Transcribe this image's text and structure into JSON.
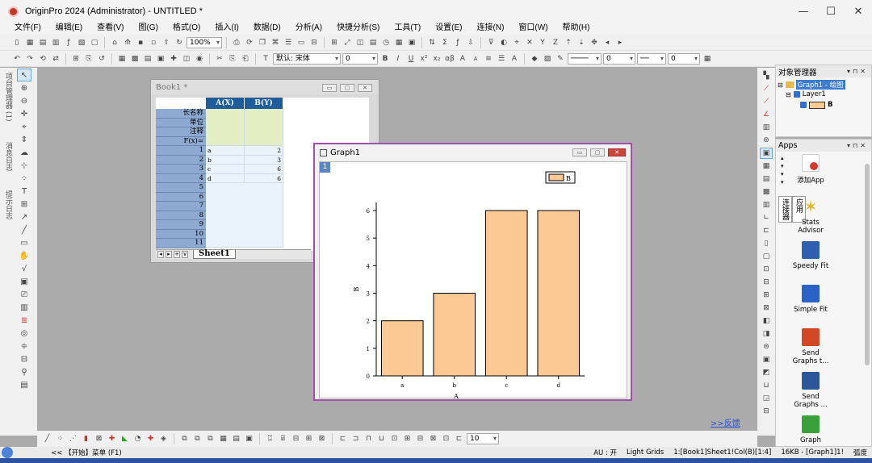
{
  "window": {
    "title": "OriginPro 2024 (Administrator) - UNTITLED *",
    "min_icon": "—",
    "max_icon": "☐",
    "close_icon": "✕"
  },
  "menu": [
    "文件(F)",
    "编辑(E)",
    "查看(V)",
    "图(G)",
    "格式(O)",
    "插入(I)",
    "数据(D)",
    "分析(A)",
    "快捷分析(S)",
    "工具(T)",
    "设置(E)",
    "连接(N)",
    "窗口(W)",
    "帮助(H)"
  ],
  "toolbar": {
    "zoom": "100%",
    "font": "默认: 宋体",
    "font_size": "0",
    "bold": "B",
    "italic": "I",
    "underline": "U",
    "x2": "x²",
    "x_2": "x₂",
    "greek": "αβ",
    "bigA": "A",
    "smallA": "A",
    "line_width": "0",
    "font_size2": "0",
    "sym_size": "10"
  },
  "left_labels": [
    "项目管理器 (1)",
    "消息日志",
    "提示日志"
  ],
  "book": {
    "title": "Book1 *",
    "columns": [
      "A(X)",
      "B(Y)"
    ],
    "header_rows": [
      "长名称",
      "单位",
      "注释",
      "F(x)="
    ],
    "row_numbers": [
      "1",
      "2",
      "3",
      "4",
      "5",
      "6",
      "7",
      "8",
      "9",
      "10",
      "11"
    ],
    "col_a": [
      "a",
      "b",
      "c",
      "d"
    ],
    "col_b": [
      "2",
      "3",
      "6",
      "6"
    ],
    "sheet_tab": "Sheet1",
    "nav": [
      "◂",
      "▸",
      "+",
      "∨"
    ]
  },
  "graph": {
    "title": "Graph1",
    "layer": "1",
    "legend_label": "B",
    "xlabel": "A",
    "ylabel": "B"
  },
  "chart_data": {
    "type": "bar",
    "categories": [
      "a",
      "b",
      "c",
      "d"
    ],
    "values": [
      2,
      3,
      6,
      6
    ],
    "xlabel": "A",
    "ylabel": "B",
    "ylim": [
      0,
      6
    ],
    "yticks": [
      "0",
      "1",
      "2",
      "3",
      "4",
      "5",
      "6"
    ],
    "bar_color": "#fcc994",
    "legend": {
      "entries": [
        "B"
      ],
      "placement": "top-right"
    }
  },
  "object_manager": {
    "title": "对象管理器",
    "graph_node": "Graph1 - 绘图",
    "layer_node": "Layer1",
    "plot_node": "B"
  },
  "apps": {
    "title": "Apps",
    "tabs": [
      "应用",
      "连接器"
    ],
    "items": [
      {
        "label": "添加App",
        "color": "#d33b2f"
      },
      {
        "label": "Stats Advisor",
        "color": "#e8b41f"
      },
      {
        "label": "Speedy Fit",
        "color": "#2f5fb0"
      },
      {
        "label": "Simple Fit",
        "color": "#2a63c8"
      },
      {
        "label": "Send Graphs t...",
        "color": "#d24726"
      },
      {
        "label": "Send Graphs ...",
        "color": "#2b579a"
      },
      {
        "label": "Graph",
        "color": "#3aa03a"
      }
    ]
  },
  "feedback": ">>反馈",
  "status": {
    "left": "<<  【开始】菜单 (F1)",
    "au": "AU : 开",
    "grids": "Light Grids",
    "sel": "1:[Book1]Sheet1!Col(B)[1:4]",
    "mem": "16KB - [Graph1]1!",
    "unit": "弧度"
  },
  "colors": {
    "accent": "#1f5c9a",
    "bar": "#fcc994",
    "graph_border": "#a14fa8",
    "taskbar": "#2d52a2"
  }
}
